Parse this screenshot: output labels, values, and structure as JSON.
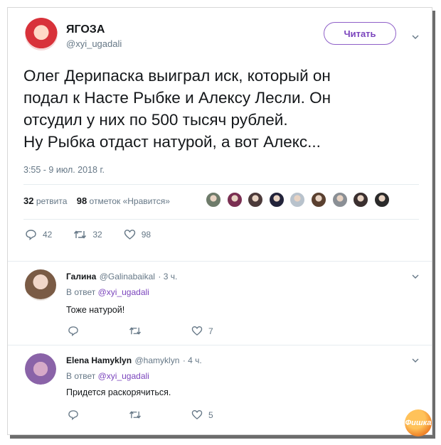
{
  "tweet": {
    "display_name": "ЯГОЗА",
    "username": "@xyi_ugadali",
    "follow_label": "Читать",
    "text_lines": [
      "Олег Дерипаска выиграл иск, который он",
      "подал к Насте Рыбке и Алексу Лесли. Он",
      "отсудил у них по 500 тысяч рублей.",
      "Ну Рыбка отдаст натурой, а вот Алекс..."
    ],
    "timestamp": "3:55 - 9 июл. 2018 г.",
    "retweets_count": "32",
    "retweets_label": "ретвита",
    "likes_count": "98",
    "likes_label": "отметок «Нравится»",
    "actions": {
      "replies": "42",
      "retweets": "32",
      "likes": "98"
    }
  },
  "liker_avatar_colors": [
    "#6e7b6a",
    "#7a2f52",
    "#4c3a3a",
    "#22233a",
    "#b8c2cc",
    "#5a4030",
    "#8a8f95",
    "#3a2f2f",
    "#2a2a2a"
  ],
  "replies": [
    {
      "name": "Галина",
      "handle": "@Galinabaikal",
      "time": "· 3 ч.",
      "reply_prefix": "В ответ",
      "reply_to": "@xyi_ugadali",
      "text": "Тоже натурой!",
      "likes": "7"
    },
    {
      "name": "Elena Hamyklyn",
      "handle": "@hamyklyn",
      "time": "· 4 ч.",
      "reply_prefix": "В ответ",
      "reply_to": "@xyi_ugadali",
      "text": "Придется раскорячиться.",
      "likes": "5"
    }
  ],
  "watermark": "Фишка",
  "colors": {
    "accent": "#7b45bd",
    "muted": "#657786",
    "text": "#14171a"
  }
}
